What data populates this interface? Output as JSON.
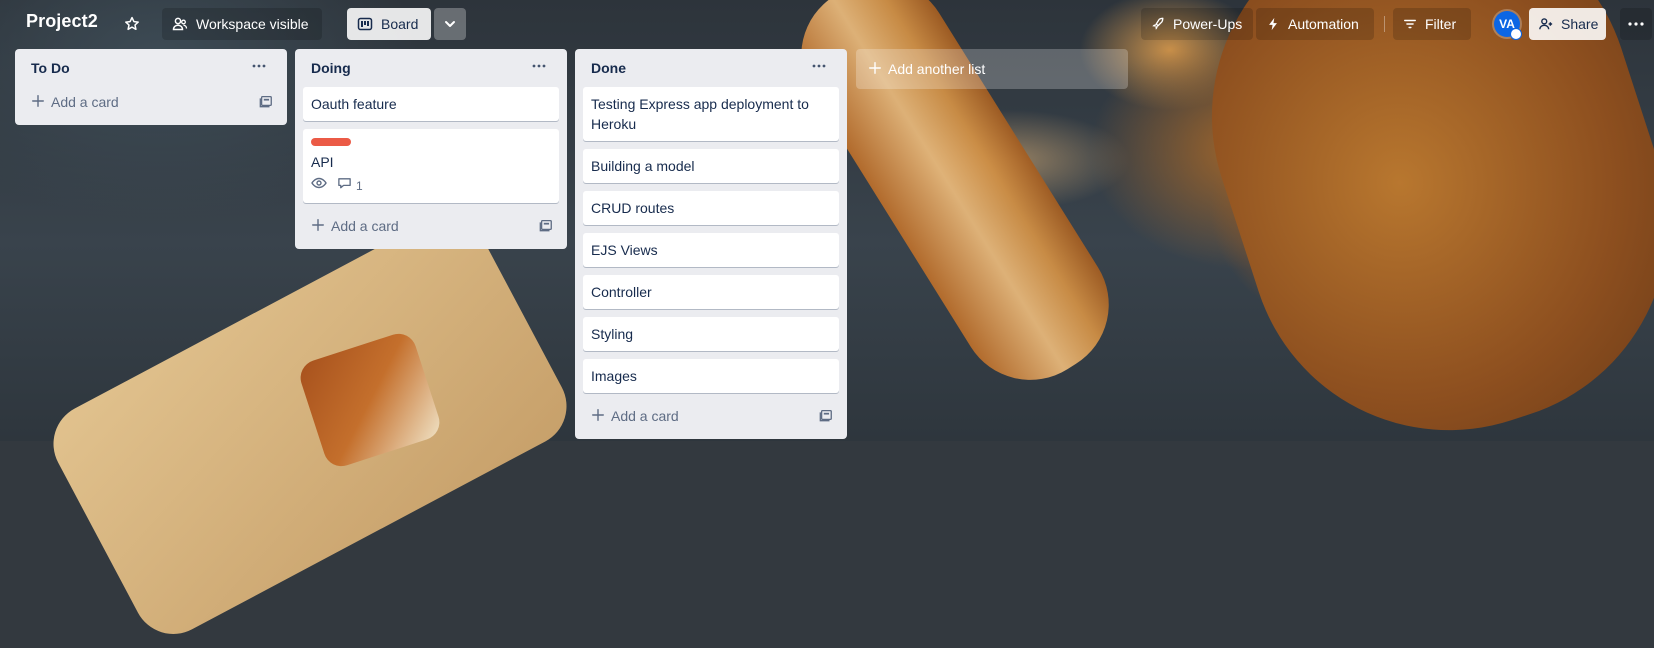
{
  "header": {
    "board_title": "Project2",
    "visibility_label": "Workspace visible",
    "view_label": "Board",
    "powerups_label": "Power-Ups",
    "automation_label": "Automation",
    "filter_label": "Filter",
    "avatar_initials": "VA",
    "share_label": "Share"
  },
  "lists": [
    {
      "title": "To Do",
      "cards": [],
      "add_card_label": "Add a card"
    },
    {
      "title": "Doing",
      "cards": [
        {
          "title": "Oauth feature"
        },
        {
          "title": "API",
          "label_color": "#eb5a46",
          "badges": {
            "watching": true,
            "comments": "1"
          }
        }
      ],
      "add_card_label": "Add a card"
    },
    {
      "title": "Done",
      "cards": [
        {
          "title": "Testing Express app deployment to Heroku"
        },
        {
          "title": "Building a model"
        },
        {
          "title": "CRUD routes"
        },
        {
          "title": "EJS Views"
        },
        {
          "title": "Controller"
        },
        {
          "title": "Styling"
        },
        {
          "title": "Images"
        }
      ],
      "add_card_label": "Add a card"
    }
  ],
  "add_list_label": "Add another list",
  "icons": {
    "star": "star-icon",
    "visibility": "people-icon",
    "board": "board-icon",
    "view_switch": "chevron-down-icon",
    "powerups": "rocket-icon",
    "automation": "lightning-icon",
    "filter": "filter-icon",
    "share": "person-add-icon",
    "more": "more-icon",
    "list_menu": "ellipsis-icon",
    "add": "plus-icon",
    "template": "template-icon",
    "watch": "eye-icon",
    "comment": "comment-icon"
  },
  "colors": {
    "accent": "#0c66e4",
    "list_bg": "#ebecf0",
    "label_red": "#eb5a46"
  }
}
